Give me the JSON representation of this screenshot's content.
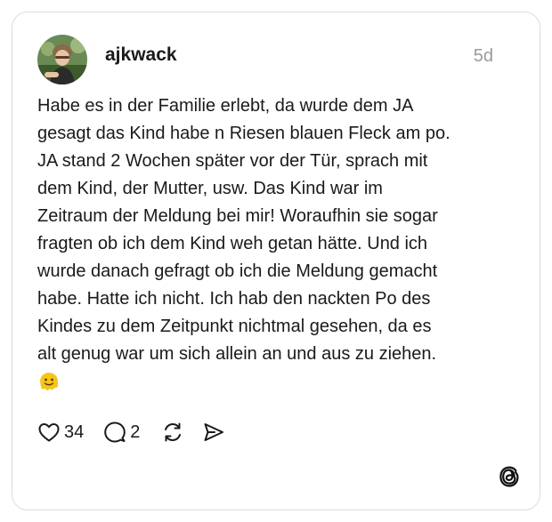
{
  "post": {
    "username": "ajkwack",
    "timestamp": "5d",
    "text": "Habe es in der Familie erlebt, da wurde dem JA\ngesagt das Kind habe n Riesen blauen Fleck am po.\nJA stand 2 Wochen später vor der Tür, sprach mit\ndem Kind, der Mutter, usw. Das Kind war im\nZeitraum der Meldung bei mir! Woraufhin sie sogar\nfragten ob ich dem Kind weh getan hätte. Und ich\nwurde danach gefragt ob ich die Meldung gemacht\nhabe. Hatte ich nicht. Ich hab den nackten Po des\nKindes zu dem Zeitpunkt nichtmal gesehen, da es\nalt genug war um sich allein an und aus zu ziehen.",
    "emoji": "melting-face-emoji"
  },
  "actions": {
    "like_count": "34",
    "reply_count": "2",
    "icons": [
      "heart-icon",
      "comment-icon",
      "repost-icon",
      "share-icon"
    ]
  },
  "brand": {
    "logo": "threads-logo-icon",
    "emoji_color": "#f5c518"
  }
}
